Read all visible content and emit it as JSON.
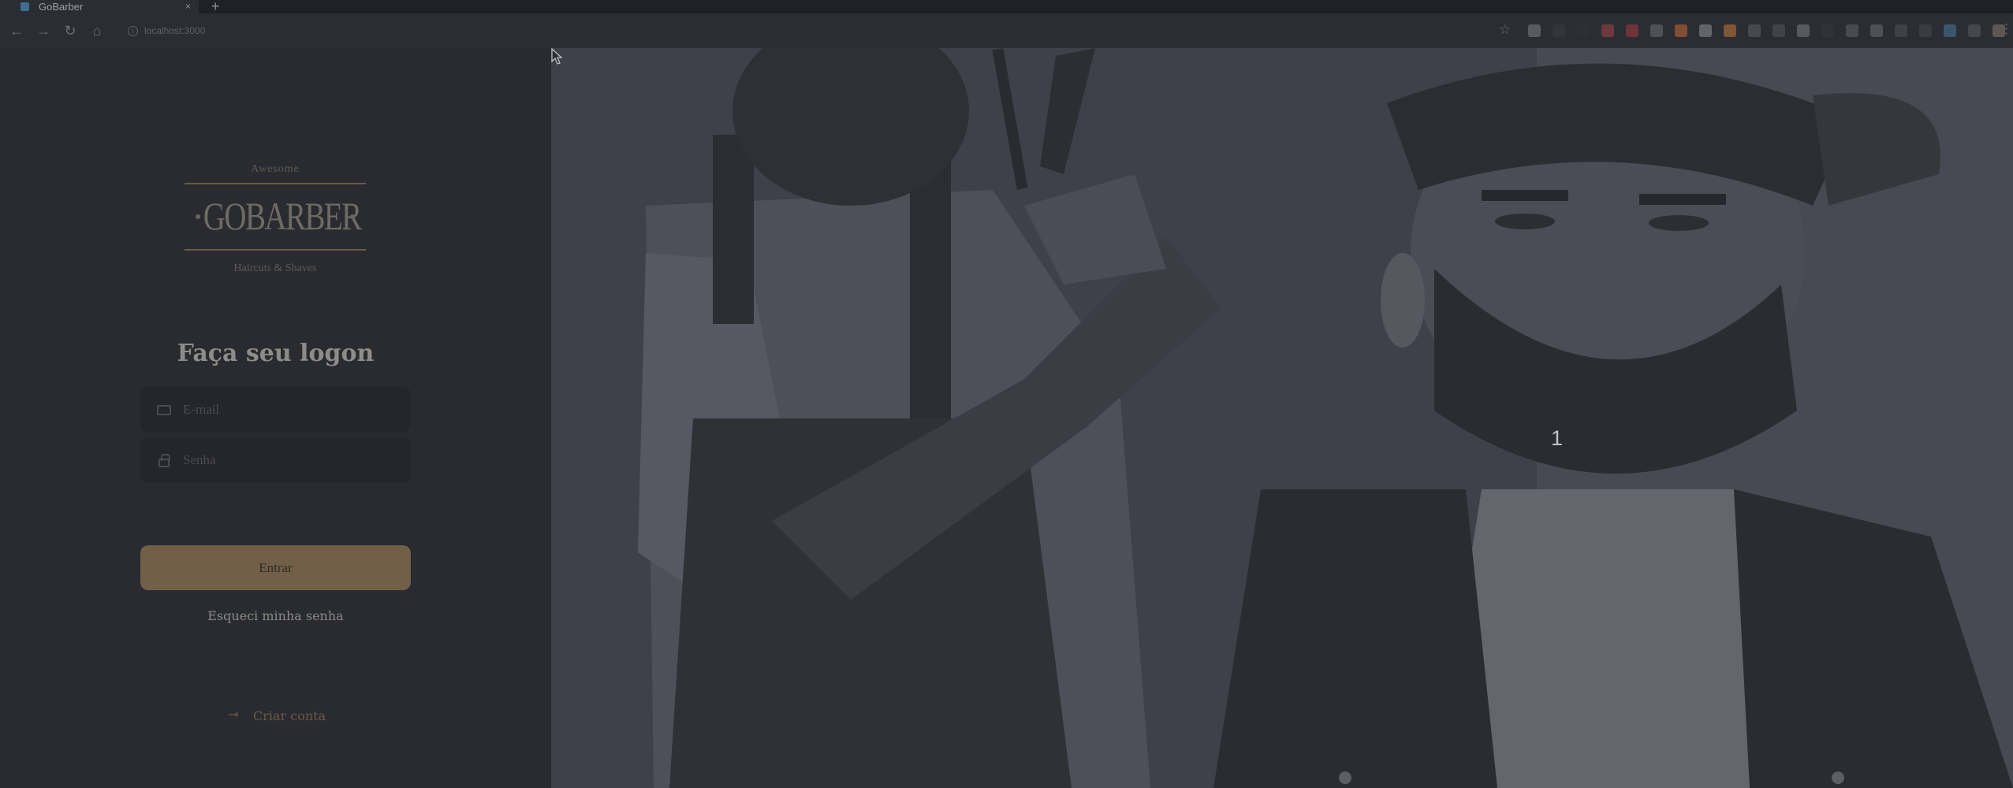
{
  "browser": {
    "tab_title": "GoBarber",
    "tab_close": "×",
    "new_tab": "+",
    "url": "localhost:3000"
  },
  "login": {
    "logo_top": "Awesome",
    "logo_main": "GOBARBER",
    "logo_bottom": "Haircuts & Shaves",
    "title": "Faça seu logon",
    "email_placeholder": "E-mail",
    "password_placeholder": "Senha",
    "enter_button": "Entrar",
    "forgot_link": "Esqueci minha senha",
    "create_account": "Criar conta"
  },
  "overlay": {
    "number": "1"
  },
  "colors": {
    "accent": "#ff9000",
    "background": "#312e38"
  },
  "icons": [
    "back-icon",
    "forward-icon",
    "reload-icon",
    "home-icon",
    "info-icon",
    "star-icon",
    "mail-icon",
    "lock-icon",
    "login-icon",
    "cursor-icon"
  ]
}
